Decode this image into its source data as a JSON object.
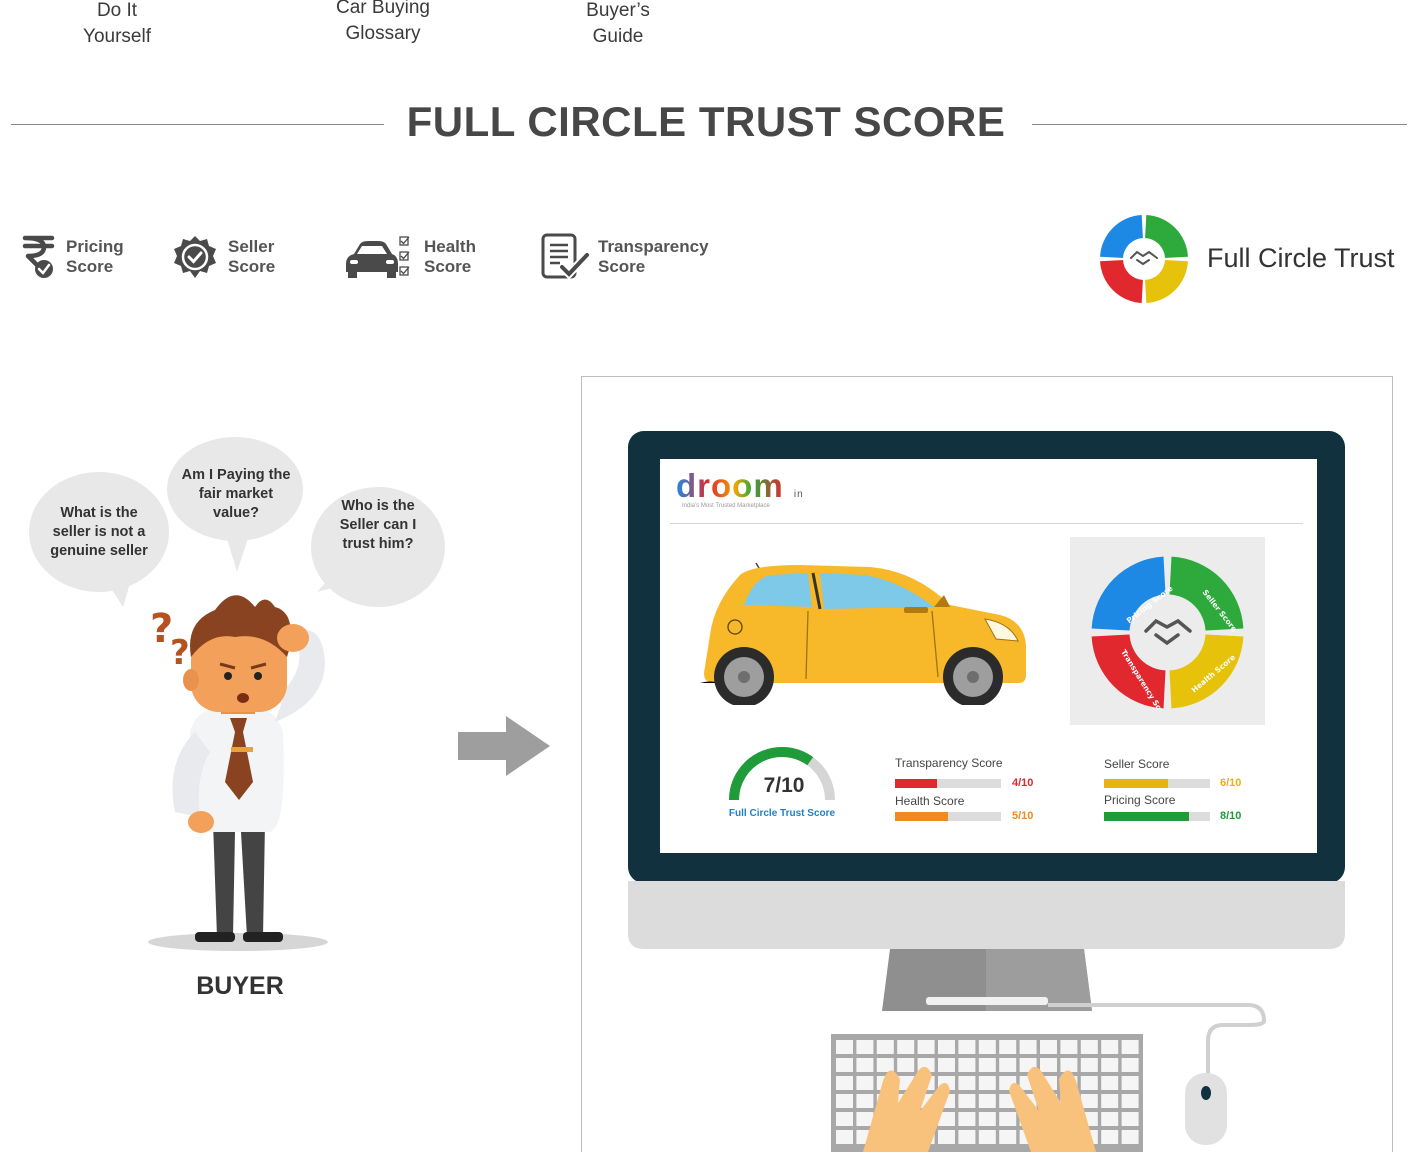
{
  "topnav": {
    "items": [
      {
        "line1": "Do It",
        "line2": "Yourself"
      },
      {
        "line1": "Car Buying",
        "line2": "Glossary"
      },
      {
        "line1": "Buyer’s",
        "line2": "Guide"
      }
    ]
  },
  "section": {
    "title": "FULL CIRCLE TRUST SCORE"
  },
  "scores": {
    "chips": [
      {
        "line1": "Pricing",
        "line2": "Score",
        "icon": "rupee-check-icon"
      },
      {
        "line1": "Seller",
        "line2": "Score",
        "icon": "badge-check-icon"
      },
      {
        "line1": "Health",
        "line2": "Score",
        "icon": "car-checklist-icon"
      },
      {
        "line1": "Transparency",
        "line2": "Score",
        "icon": "document-check-icon"
      }
    ],
    "brand_label": "Full Circle Trust",
    "ring_segments": [
      {
        "label": "Pricing Score",
        "color": "#1e88e5"
      },
      {
        "label": "Seller Score",
        "color": "#2eaa3c"
      },
      {
        "label": "Health Score",
        "color": "#e6c20b"
      },
      {
        "label": "Transparency Score",
        "color": "#e0282e"
      }
    ]
  },
  "buyer": {
    "bubbles": [
      {
        "text": "What is the seller is not a genuine seller"
      },
      {
        "text": "Am I Paying the fair market value?"
      },
      {
        "text": "Who is the Seller can I trust him?"
      }
    ],
    "label": "BUYER"
  },
  "screen": {
    "logo": "droom",
    "logo_suffix": "in",
    "tagline": "India's Most Trusted Marketplace",
    "gauge": {
      "value_text": "7/10",
      "caption": "Full Circle Trust Score",
      "value": 7,
      "max": 10
    },
    "bars": [
      {
        "label": "Transparency Score",
        "value_text": "4/10",
        "value": 4,
        "color": "#e0282e"
      },
      {
        "label": "Health Score",
        "value_text": "5/10",
        "value": 5,
        "color": "#f08a1c"
      },
      {
        "label": "Seller Score",
        "value_text": "6/10",
        "value": 6,
        "color": "#e6b40b"
      },
      {
        "label": "Pricing Score",
        "value_text": "8/10",
        "value": 8,
        "color": "#1f9b3a"
      }
    ]
  },
  "colors": {
    "monitor_bezel": "#12313f",
    "monitor_chin": "#dcdcdc",
    "car_body": "#f7b829",
    "arrow": "#9e9e9e"
  }
}
